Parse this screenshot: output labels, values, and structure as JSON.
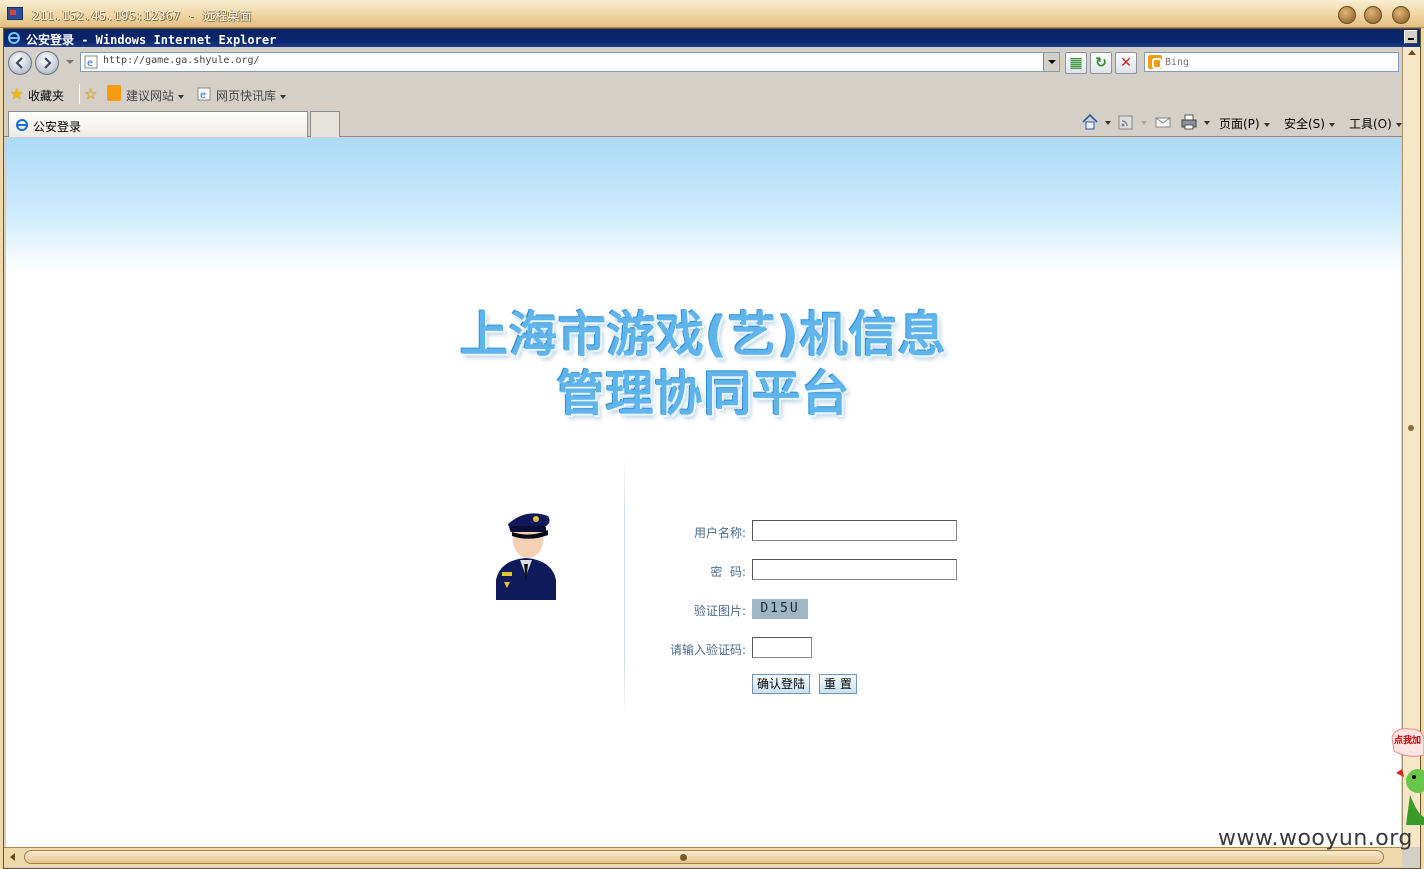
{
  "rdp": {
    "title": "211.152.45.195:12367 - 远程桌面"
  },
  "browser": {
    "title": "公安登录 - Windows Internet Explorer",
    "address": "http://game.ga.shyule.org/",
    "search_placeholder": "Bing"
  },
  "favorites": {
    "label": "收藏夹",
    "items": [
      {
        "label": "建议网站"
      },
      {
        "label": "网页快讯库"
      }
    ]
  },
  "tabs": [
    {
      "label": "公安登录"
    }
  ],
  "commands": {
    "page": "页面(P)",
    "safety": "安全(S)",
    "tools": "工具(O)"
  },
  "page": {
    "title_line1": "上海市游戏(艺)机信息",
    "title_line2": "管理协同平台",
    "form": {
      "username_label": "用户名称:",
      "password_label": "密  码:",
      "captcha_label": "验证图片:",
      "captcha_value": "D15U",
      "captcha_input_label": "请输入验证码:",
      "username_value": "",
      "password_value": "",
      "captcha_input_value": "",
      "submit_label": "确认登陆",
      "reset_label": "重 置"
    }
  },
  "floating_ad": {
    "label": "点我加"
  },
  "watermark": "www.wooyun.org"
}
